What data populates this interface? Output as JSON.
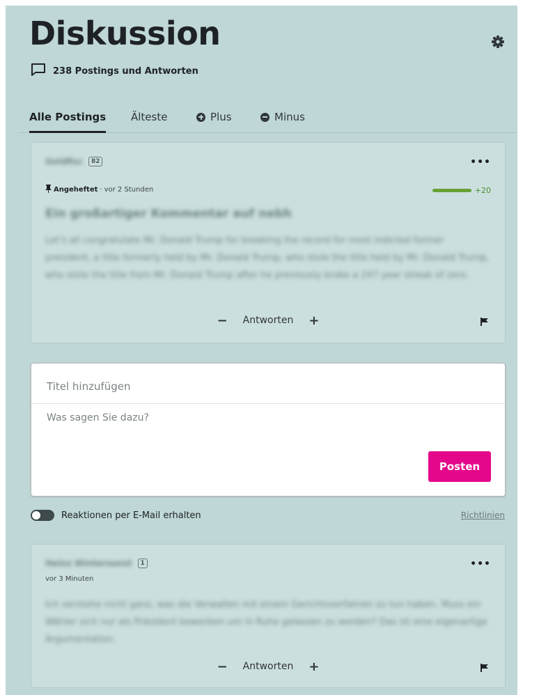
{
  "header": {
    "title": "Diskussion",
    "count_text": "238 Postings und Antworten"
  },
  "tabs": [
    {
      "label": "Alle Postings",
      "active": true
    },
    {
      "label": "Älteste",
      "active": false
    },
    {
      "label": "Plus",
      "active": false,
      "icon": "plus-circle-icon"
    },
    {
      "label": "Minus",
      "active": false,
      "icon": "minus-circle-icon"
    }
  ],
  "posts": [
    {
      "author": "Goldfisc",
      "badge": "82",
      "pinned_label": "Angeheftet",
      "separator": "·",
      "time": "vor 2 Stunden",
      "rating": "+20",
      "title": "Ein großartiger Kommentar auf nebh",
      "body": "Let's all congratulate Mr. Donald Trump for breaking the record for most indicted former president, a title formerly held by Mr. Donald Trump, who stole the title held by Mr. Donald Trump, who stole the title from Mr. Donald Trump after he previously broke a 247 year streak of zero.",
      "reply_label": "Antworten"
    },
    {
      "author": "Heinz Wintersonst",
      "badge": "1",
      "time": "vor 3 Minuten",
      "body": "Ich verstehe nicht ganz, was die Verwalten mit einem Gerichtsverfahren zu tun haben. Muss ein Wähler sich nur als Präsident bewerben um in Ruhe gelassen zu werden? Das ist eine eigenartige Argumentation.",
      "reply_label": "Antworten"
    }
  ],
  "composer": {
    "title_placeholder": "Titel hinzufügen",
    "body_placeholder": "Was sagen Sie dazu?",
    "submit_label": "Posten"
  },
  "notifications": {
    "toggle_label": "Reaktionen per E-Mail erhalten",
    "guidelines_link": "Richtlinien"
  },
  "colors": {
    "background": "#bfd7d6",
    "card": "#ccdfdf",
    "accent": "#e5078b",
    "rating_positive": "#67a135"
  }
}
